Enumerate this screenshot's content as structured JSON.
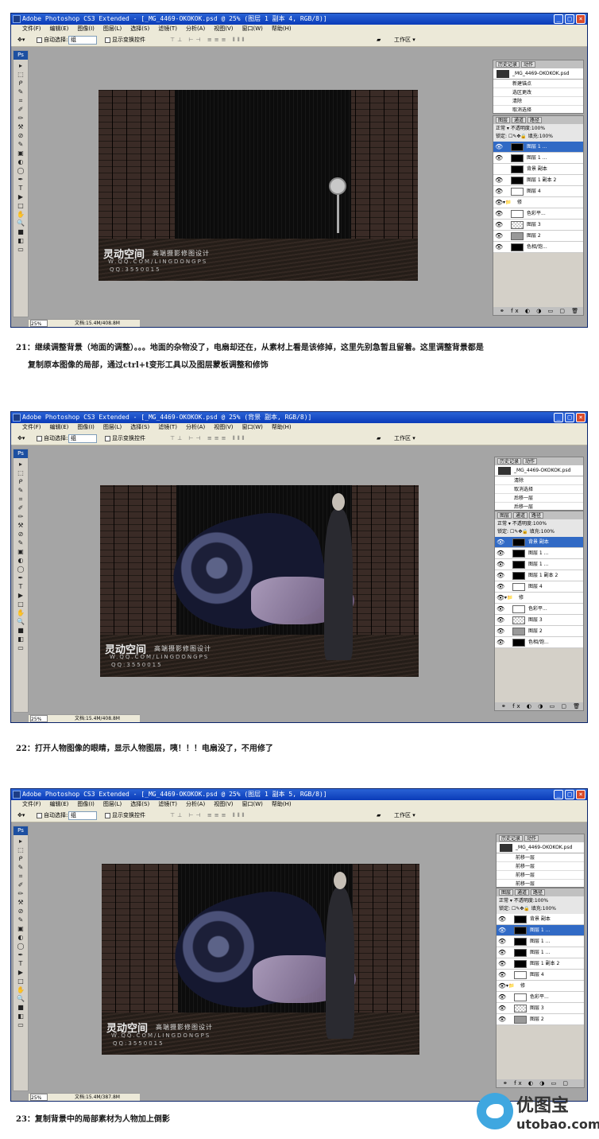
{
  "screens": [
    {
      "title": "Adobe Photoshop CS3 Extended - [_MG_4469-OKOKOK.psd @ 25% (图层 1 副本 4, RGB/8)]",
      "history_tabs": [
        "历史记录",
        "动作"
      ],
      "history_doc": "_MG_4469-OKOKOK.psd",
      "history": [
        "新建锚点",
        "选区更改",
        "清除",
        "取消选择"
      ],
      "layer_tabs": [
        "图层",
        "通道",
        "路径"
      ],
      "blend": "正常",
      "opacity_label": "不透明度:",
      "opacity": "100%",
      "lock_label": "锁定:",
      "fill_label": "填充:",
      "fill": "100%",
      "layers": [
        {
          "name": "图层 1 ...",
          "thumb": "dark",
          "selected": true,
          "eye": true
        },
        {
          "name": "图层 1 ...",
          "thumb": "dark",
          "selected": false,
          "eye": true
        },
        {
          "name": "背景 副本",
          "thumb": "dark",
          "selected": false,
          "eye": false
        },
        {
          "name": "图层 1 副本 2",
          "thumb": "dark",
          "selected": false,
          "eye": true
        },
        {
          "name": "图层 4",
          "thumb": "white",
          "selected": false,
          "eye": true
        },
        {
          "name": "修",
          "thumb": "group",
          "selected": false,
          "eye": true
        },
        {
          "name": "色彩平...",
          "thumb": "white",
          "selected": false,
          "eye": true
        },
        {
          "name": "图层 3",
          "thumb": "check",
          "selected": false,
          "eye": true
        },
        {
          "name": "图层 2",
          "thumb": "gray",
          "selected": false,
          "eye": true
        },
        {
          "name": "色相/饱...",
          "thumb": "dark",
          "selected": false,
          "eye": true
        }
      ],
      "zoom": "25%",
      "docsize": "文档:15.4M/408.8M"
    },
    {
      "title": "Adobe Photoshop CS3 Extended - [_MG_4469-OKOKOK.psd @ 25% (背景 副本, RGB/8)]",
      "history_tabs": [
        "历史记录",
        "动作"
      ],
      "history_doc": "_MG_4469-OKOKOK.psd",
      "history": [
        "清除",
        "取消选择",
        "后移一层",
        "后移一层"
      ],
      "layer_tabs": [
        "图层",
        "通道",
        "路径"
      ],
      "blend": "正常",
      "opacity_label": "不透明度:",
      "opacity": "100%",
      "lock_label": "锁定:",
      "fill_label": "填充:",
      "fill": "100%",
      "layers": [
        {
          "name": "背景 副本",
          "thumb": "dark",
          "selected": true,
          "eye": true
        },
        {
          "name": "图层 1 ...",
          "thumb": "dark",
          "selected": false,
          "eye": true
        },
        {
          "name": "图层 1 ...",
          "thumb": "dark",
          "selected": false,
          "eye": true
        },
        {
          "name": "图层 1 副本 2",
          "thumb": "dark",
          "selected": false,
          "eye": true
        },
        {
          "name": "图层 4",
          "thumb": "white",
          "selected": false,
          "eye": true
        },
        {
          "name": "修",
          "thumb": "group",
          "selected": false,
          "eye": true
        },
        {
          "name": "色彩平...",
          "thumb": "white",
          "selected": false,
          "eye": true
        },
        {
          "name": "图层 3",
          "thumb": "check",
          "selected": false,
          "eye": true
        },
        {
          "name": "图层 2",
          "thumb": "gray",
          "selected": false,
          "eye": true
        },
        {
          "name": "色相/饱...",
          "thumb": "dark",
          "selected": false,
          "eye": true
        }
      ],
      "zoom": "25%",
      "docsize": "文档:15.4M/408.8M"
    },
    {
      "title": "Adobe Photoshop CS3 Extended - [_MG_4469-OKOKOK.psd @ 25% (图层 1 副本 5, RGB/8)]",
      "history_tabs": [
        "历史记录",
        "动作"
      ],
      "history_doc": "_MG_4469-OKOKOK.psd",
      "history": [
        "前移一层",
        "前移一层",
        "前移一层",
        "前移一层"
      ],
      "layer_tabs": [
        "图层",
        "通道",
        "路径"
      ],
      "blend": "正常",
      "opacity_label": "不透明度:",
      "opacity": "100%",
      "lock_label": "锁定:",
      "fill_label": "填充:",
      "fill": "100%",
      "layers": [
        {
          "name": "背景 副本",
          "thumb": "dark",
          "selected": false,
          "eye": true
        },
        {
          "name": "图层 1 ...",
          "thumb": "dark",
          "selected": true,
          "eye": true
        },
        {
          "name": "图层 1 ...",
          "thumb": "dark",
          "selected": false,
          "eye": true
        },
        {
          "name": "图层 1 ...",
          "thumb": "dark",
          "selected": false,
          "eye": true
        },
        {
          "name": "图层 1 副本 2",
          "thumb": "dark",
          "selected": false,
          "eye": true
        },
        {
          "name": "图层 4",
          "thumb": "white",
          "selected": false,
          "eye": true
        },
        {
          "name": "修",
          "thumb": "group",
          "selected": false,
          "eye": true
        },
        {
          "name": "色彩平...",
          "thumb": "white",
          "selected": false,
          "eye": true
        },
        {
          "name": "图层 3",
          "thumb": "check",
          "selected": false,
          "eye": true
        },
        {
          "name": "图层 2",
          "thumb": "gray",
          "selected": false,
          "eye": true
        }
      ],
      "zoom": "25%",
      "docsize": "文档:15.4M/387.8M"
    }
  ],
  "menu": [
    "文件(F)",
    "编辑(E)",
    "图像(I)",
    "图层(L)",
    "选择(S)",
    "滤镜(T)",
    "分析(A)",
    "视图(V)",
    "窗口(W)",
    "帮助(H)"
  ],
  "options": {
    "auto_select": "自动选择:",
    "auto_select_value": "组",
    "show_transform": "显示变换控件",
    "workspace": "工作区 ▾"
  },
  "tools": [
    "▸",
    "⬚",
    "ᑭ",
    "✎",
    "⌗",
    "✐",
    "✏",
    "⚒",
    "⊘",
    "✎",
    "▣",
    "◐",
    "◯",
    "✒",
    "T",
    "▶",
    "□",
    "✋",
    "🔍",
    "■",
    "◧",
    "▭"
  ],
  "watermark": {
    "cn": "灵动空间",
    "cn2": "高端摄影修图设计",
    "url": "W.QQ.COM/LINGDONGPS",
    "qq": "QQ:3550015"
  },
  "captions": {
    "c21a": "21：继续调整背景（地面的调整）。。。地面的杂物没了，电扇却还在，从素材上看是该修掉，这里先别急暂且留着。这里调整背景都是",
    "c21b": "复制原本图像的局部，通过ctrl+t变形工具以及图层蒙板调整和修饰",
    "c22": "22：打开人物图像的眼睛，显示人物图层，咦！！！电扇没了，不用修了",
    "c23": "23：复制背景中的局部素材为人物加上倒影"
  },
  "site": {
    "cn": "优图宝",
    "en": "utobao.com"
  }
}
